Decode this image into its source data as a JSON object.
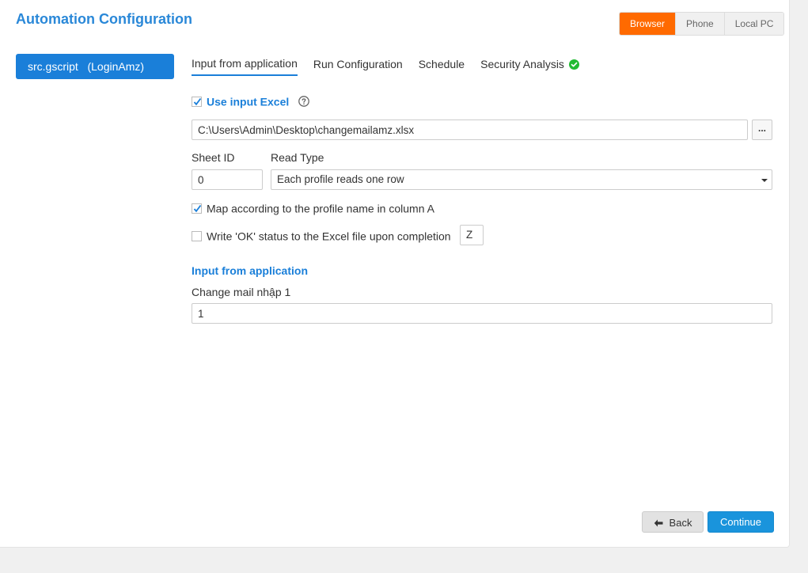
{
  "header": {
    "title": "Automation Configuration"
  },
  "platform": {
    "options": [
      "Browser",
      "Phone",
      "Local PC"
    ],
    "selected": "Browser",
    "accent": "#ff6a00"
  },
  "sidebar": {
    "script_item": "src.gscript   (LoginAmz)"
  },
  "tabs": [
    {
      "label": "Input from application",
      "active": true
    },
    {
      "label": "Run Configuration",
      "active": false
    },
    {
      "label": "Schedule",
      "active": false
    },
    {
      "label": "Security Analysis",
      "active": false,
      "status_icon": "check-circle-icon"
    }
  ],
  "excel": {
    "use_label": "Use input Excel",
    "use_checked": true,
    "path_value": "C:\\Users\\Admin\\Desktop\\changemailamz.xlsx",
    "browse_label": "...",
    "sheet_id_label": "Sheet ID",
    "sheet_id_value": "0",
    "read_type_label": "Read Type",
    "read_type_value": "Each profile reads one row",
    "map_label": "Map according to the profile name in column A",
    "map_checked": true,
    "write_ok_label": "Write 'OK' status to the Excel file upon completion",
    "write_ok_checked": false,
    "write_column_value": "Z"
  },
  "app_input": {
    "section_title": "Input from application",
    "field_label": "Change mail nhập 1",
    "field_value": "1"
  },
  "footer": {
    "back_label": "Back",
    "continue_label": "Continue"
  },
  "colors": {
    "primary": "#1a7fd9",
    "success": "#22bb33"
  }
}
